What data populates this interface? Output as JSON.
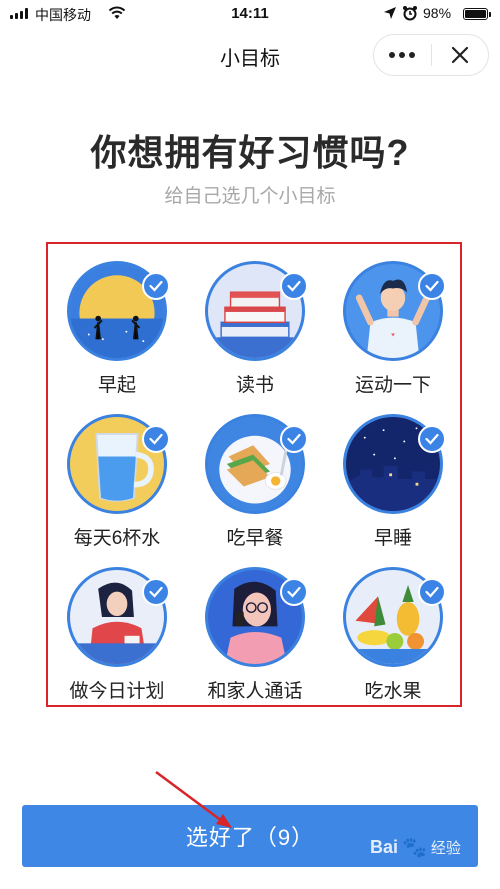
{
  "status_bar": {
    "carrier": "中国移动",
    "time": "14:11",
    "battery_percent": "98%",
    "battery_level": 0.98
  },
  "nav": {
    "title": "小目标",
    "more_icon": "more-dots-icon",
    "close_icon": "close-icon"
  },
  "heading": "你想拥有好习惯吗?",
  "subheading": "给自己选几个小目标",
  "goals": [
    {
      "label": "早起",
      "icon": "sunrise-icon",
      "checked": true
    },
    {
      "label": "读书",
      "icon": "books-icon",
      "checked": true
    },
    {
      "label": "运动一下",
      "icon": "exercise-icon",
      "checked": true
    },
    {
      "label": "每天6杯水",
      "icon": "water-glass-icon",
      "checked": true
    },
    {
      "label": "吃早餐",
      "icon": "breakfast-icon",
      "checked": true
    },
    {
      "label": "早睡",
      "icon": "night-sky-icon",
      "checked": true
    },
    {
      "label": "做今日计划",
      "icon": "planning-icon",
      "checked": true
    },
    {
      "label": "和家人通话",
      "icon": "phone-call-icon",
      "checked": true
    },
    {
      "label": "吃水果",
      "icon": "fruit-icon",
      "checked": true
    }
  ],
  "submit_label": "选好了（9）",
  "watermark": {
    "brand": "Bai",
    "suffix": "经验"
  },
  "colors": {
    "accent": "#3f87e4",
    "highlight_border": "#d9242a"
  }
}
